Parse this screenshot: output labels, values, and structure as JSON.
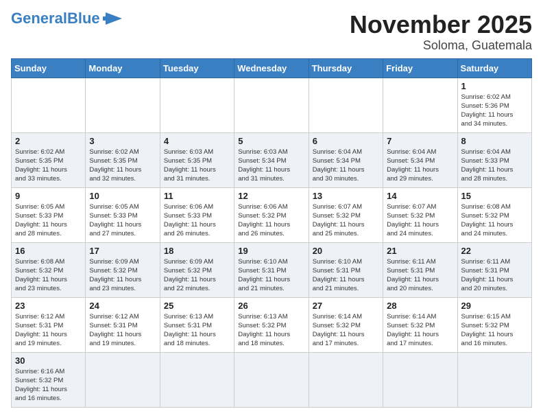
{
  "header": {
    "logo_general": "General",
    "logo_blue": "Blue",
    "month_title": "November 2025",
    "location": "Soloma, Guatemala"
  },
  "days_of_week": [
    "Sunday",
    "Monday",
    "Tuesday",
    "Wednesday",
    "Thursday",
    "Friday",
    "Saturday"
  ],
  "weeks": [
    {
      "row_style": "odd",
      "days": [
        {
          "number": "",
          "info": ""
        },
        {
          "number": "",
          "info": ""
        },
        {
          "number": "",
          "info": ""
        },
        {
          "number": "",
          "info": ""
        },
        {
          "number": "",
          "info": ""
        },
        {
          "number": "",
          "info": ""
        },
        {
          "number": "1",
          "info": "Sunrise: 6:02 AM\nSunset: 5:36 PM\nDaylight: 11 hours\nand 34 minutes."
        }
      ]
    },
    {
      "row_style": "even",
      "days": [
        {
          "number": "2",
          "info": "Sunrise: 6:02 AM\nSunset: 5:35 PM\nDaylight: 11 hours\nand 33 minutes."
        },
        {
          "number": "3",
          "info": "Sunrise: 6:02 AM\nSunset: 5:35 PM\nDaylight: 11 hours\nand 32 minutes."
        },
        {
          "number": "4",
          "info": "Sunrise: 6:03 AM\nSunset: 5:35 PM\nDaylight: 11 hours\nand 31 minutes."
        },
        {
          "number": "5",
          "info": "Sunrise: 6:03 AM\nSunset: 5:34 PM\nDaylight: 11 hours\nand 31 minutes."
        },
        {
          "number": "6",
          "info": "Sunrise: 6:04 AM\nSunset: 5:34 PM\nDaylight: 11 hours\nand 30 minutes."
        },
        {
          "number": "7",
          "info": "Sunrise: 6:04 AM\nSunset: 5:34 PM\nDaylight: 11 hours\nand 29 minutes."
        },
        {
          "number": "8",
          "info": "Sunrise: 6:04 AM\nSunset: 5:33 PM\nDaylight: 11 hours\nand 28 minutes."
        }
      ]
    },
    {
      "row_style": "odd",
      "days": [
        {
          "number": "9",
          "info": "Sunrise: 6:05 AM\nSunset: 5:33 PM\nDaylight: 11 hours\nand 28 minutes."
        },
        {
          "number": "10",
          "info": "Sunrise: 6:05 AM\nSunset: 5:33 PM\nDaylight: 11 hours\nand 27 minutes."
        },
        {
          "number": "11",
          "info": "Sunrise: 6:06 AM\nSunset: 5:33 PM\nDaylight: 11 hours\nand 26 minutes."
        },
        {
          "number": "12",
          "info": "Sunrise: 6:06 AM\nSunset: 5:32 PM\nDaylight: 11 hours\nand 26 minutes."
        },
        {
          "number": "13",
          "info": "Sunrise: 6:07 AM\nSunset: 5:32 PM\nDaylight: 11 hours\nand 25 minutes."
        },
        {
          "number": "14",
          "info": "Sunrise: 6:07 AM\nSunset: 5:32 PM\nDaylight: 11 hours\nand 24 minutes."
        },
        {
          "number": "15",
          "info": "Sunrise: 6:08 AM\nSunset: 5:32 PM\nDaylight: 11 hours\nand 24 minutes."
        }
      ]
    },
    {
      "row_style": "even",
      "days": [
        {
          "number": "16",
          "info": "Sunrise: 6:08 AM\nSunset: 5:32 PM\nDaylight: 11 hours\nand 23 minutes."
        },
        {
          "number": "17",
          "info": "Sunrise: 6:09 AM\nSunset: 5:32 PM\nDaylight: 11 hours\nand 23 minutes."
        },
        {
          "number": "18",
          "info": "Sunrise: 6:09 AM\nSunset: 5:32 PM\nDaylight: 11 hours\nand 22 minutes."
        },
        {
          "number": "19",
          "info": "Sunrise: 6:10 AM\nSunset: 5:31 PM\nDaylight: 11 hours\nand 21 minutes."
        },
        {
          "number": "20",
          "info": "Sunrise: 6:10 AM\nSunset: 5:31 PM\nDaylight: 11 hours\nand 21 minutes."
        },
        {
          "number": "21",
          "info": "Sunrise: 6:11 AM\nSunset: 5:31 PM\nDaylight: 11 hours\nand 20 minutes."
        },
        {
          "number": "22",
          "info": "Sunrise: 6:11 AM\nSunset: 5:31 PM\nDaylight: 11 hours\nand 20 minutes."
        }
      ]
    },
    {
      "row_style": "odd",
      "days": [
        {
          "number": "23",
          "info": "Sunrise: 6:12 AM\nSunset: 5:31 PM\nDaylight: 11 hours\nand 19 minutes."
        },
        {
          "number": "24",
          "info": "Sunrise: 6:12 AM\nSunset: 5:31 PM\nDaylight: 11 hours\nand 19 minutes."
        },
        {
          "number": "25",
          "info": "Sunrise: 6:13 AM\nSunset: 5:31 PM\nDaylight: 11 hours\nand 18 minutes."
        },
        {
          "number": "26",
          "info": "Sunrise: 6:13 AM\nSunset: 5:32 PM\nDaylight: 11 hours\nand 18 minutes."
        },
        {
          "number": "27",
          "info": "Sunrise: 6:14 AM\nSunset: 5:32 PM\nDaylight: 11 hours\nand 17 minutes."
        },
        {
          "number": "28",
          "info": "Sunrise: 6:14 AM\nSunset: 5:32 PM\nDaylight: 11 hours\nand 17 minutes."
        },
        {
          "number": "29",
          "info": "Sunrise: 6:15 AM\nSunset: 5:32 PM\nDaylight: 11 hours\nand 16 minutes."
        }
      ]
    },
    {
      "row_style": "even",
      "days": [
        {
          "number": "30",
          "info": "Sunrise: 6:16 AM\nSunset: 5:32 PM\nDaylight: 11 hours\nand 16 minutes."
        },
        {
          "number": "",
          "info": ""
        },
        {
          "number": "",
          "info": ""
        },
        {
          "number": "",
          "info": ""
        },
        {
          "number": "",
          "info": ""
        },
        {
          "number": "",
          "info": ""
        },
        {
          "number": "",
          "info": ""
        }
      ]
    }
  ]
}
